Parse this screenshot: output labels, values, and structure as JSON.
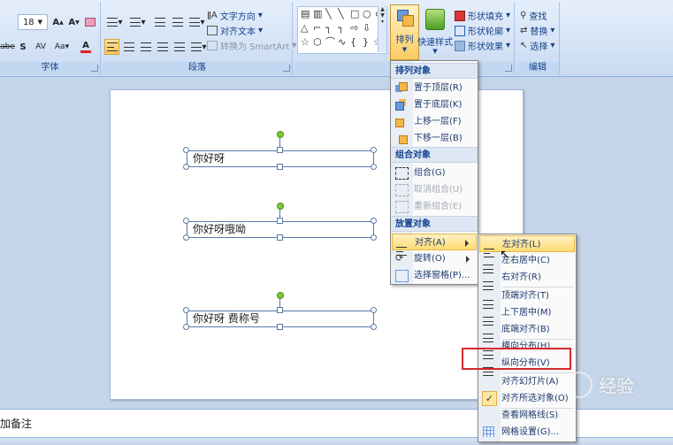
{
  "ribbon": {
    "font_group": {
      "label": "字体",
      "size_value": "18",
      "grow_icon": "A▲",
      "shrink_icon": "A▼",
      "buttons": [
        "abe",
        "S",
        "AV",
        "Aa",
        "A"
      ]
    },
    "paragraph_group": {
      "label": "段落",
      "text_direction": "文字方向",
      "align_text": "对齐文本",
      "convert_smartart": "转换为 SmartArt"
    },
    "drawing_group": {
      "arrange_label": "排列",
      "quick_styles_label": "快速样式",
      "shape_fill": "形状填充",
      "shape_outline": "形状轮廓",
      "shape_effects": "形状效果"
    },
    "editing_group": {
      "label": "编辑",
      "find": "查找",
      "replace": "替换",
      "select": "选择"
    }
  },
  "slide": {
    "textboxes": [
      {
        "text": "你好呀"
      },
      {
        "text": "你好呀哦呦"
      },
      {
        "text": "你好呀 费称号"
      }
    ]
  },
  "notes": {
    "placeholder": "加备注"
  },
  "arrange_menu": {
    "section_order": "排列对象",
    "bring_to_front": "置于顶层(R)",
    "send_to_back": "置于底层(K)",
    "bring_forward": "上移一层(F)",
    "send_backward": "下移一层(B)",
    "section_group": "组合对象",
    "group": "组合(G)",
    "ungroup": "取消组合(U)",
    "regroup": "重新组合(E)",
    "section_position": "放置对象",
    "align": "对齐(A)",
    "rotate": "旋转(O)",
    "selection_pane": "选择窗格(P)..."
  },
  "align_menu": {
    "align_left": "左对齐(L)",
    "align_center": "左右居中(C)",
    "align_right": "右对齐(R)",
    "align_top": "顶端对齐(T)",
    "align_middle": "上下居中(M)",
    "align_bottom": "底端对齐(B)",
    "distribute_horizontal": "横向分布(H)",
    "distribute_vertical": "纵向分布(V)",
    "align_to_slide": "对齐幻灯片(A)",
    "align_selected": "对齐所选对象(O)",
    "view_gridlines": "查看网格线(S)",
    "grid_settings": "网格设置(G)..."
  },
  "watermark": {
    "text": "经验"
  },
  "colors": {
    "ribbon_bg": "#d6e4f6",
    "highlight": "#fedb74",
    "annotation_red": "#d8282a",
    "rotation_handle": "#7ccb3a"
  }
}
